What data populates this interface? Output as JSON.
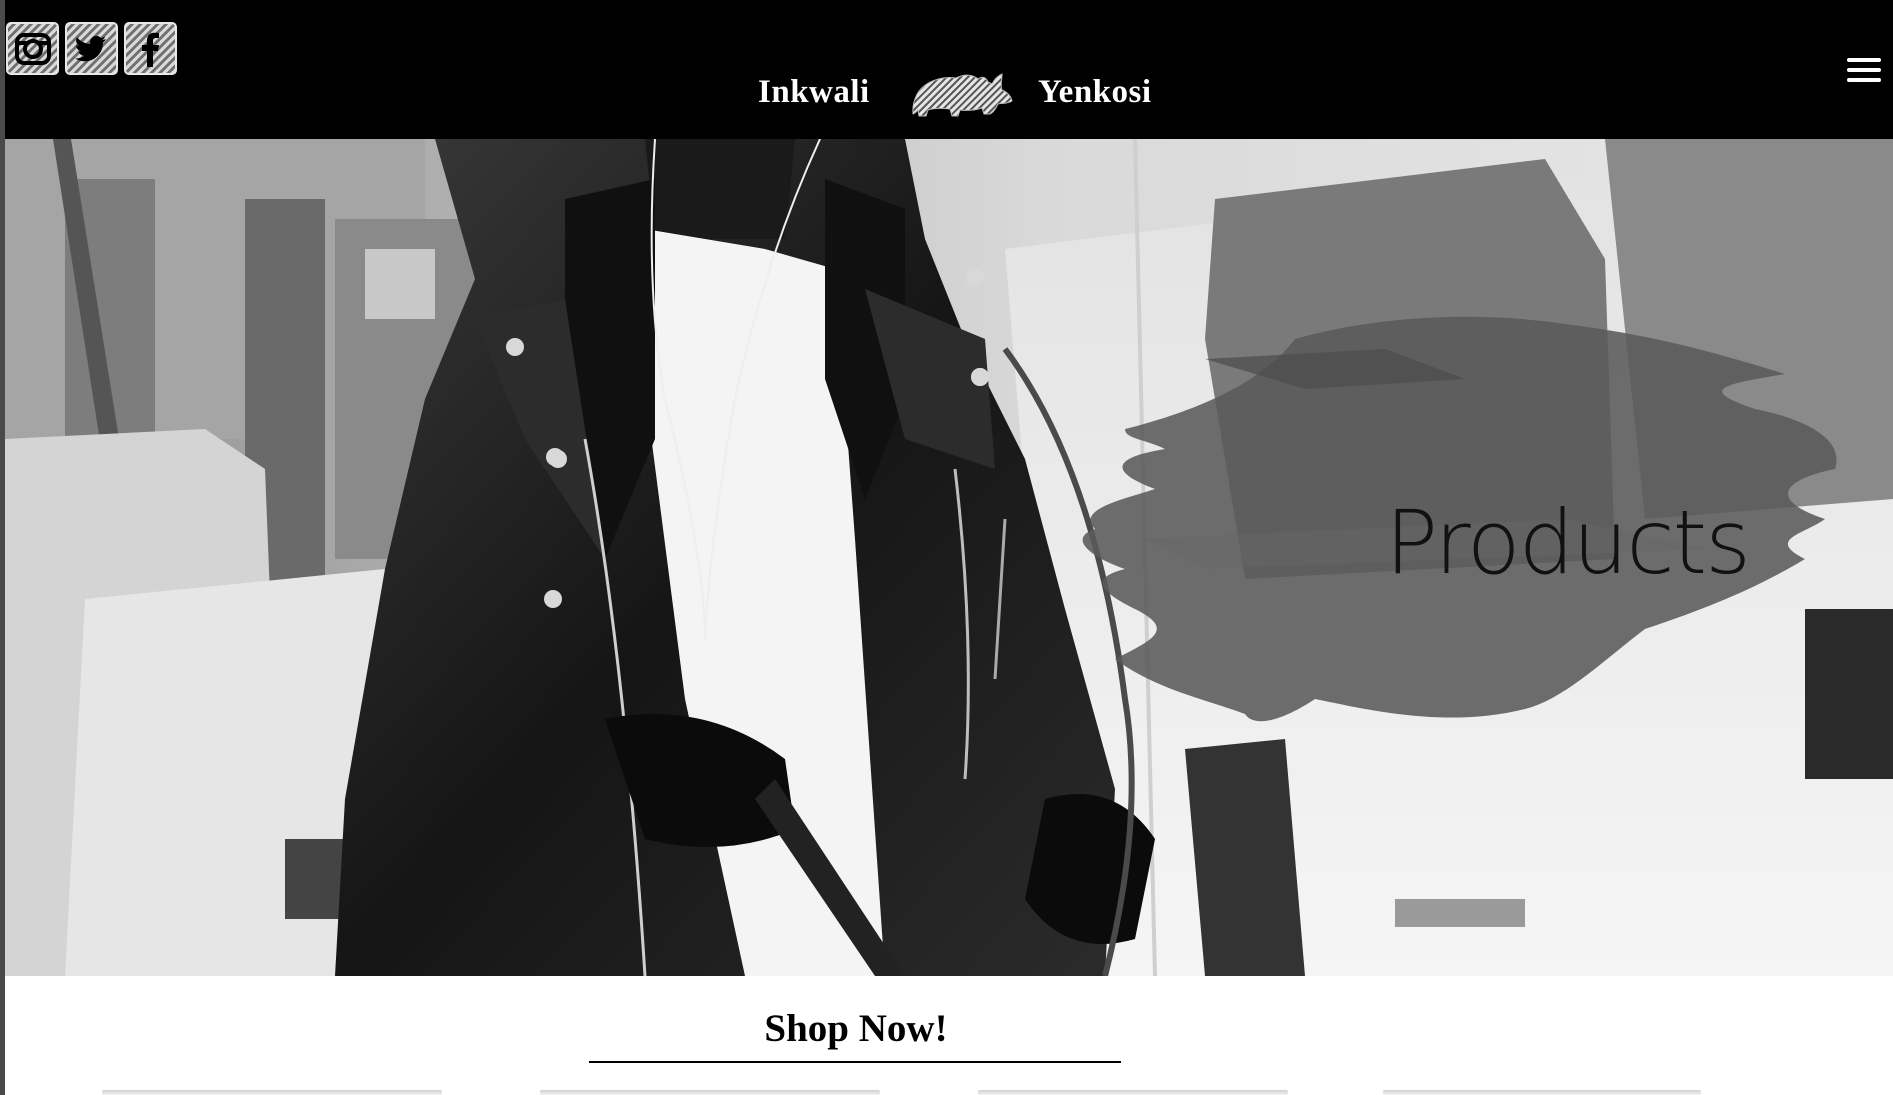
{
  "header": {
    "social": [
      {
        "icon": "instagram-icon",
        "label": "Instagram"
      },
      {
        "icon": "twitter-icon",
        "label": "Twitter"
      },
      {
        "icon": "facebook-icon",
        "label": "Facebook"
      }
    ],
    "brand_left": "Inkwali",
    "brand_right": "Yenkosi",
    "logo_icon": "rhino-logo-icon",
    "menu_icon": "hamburger-menu-icon"
  },
  "hero": {
    "label": "Products"
  },
  "shop": {
    "heading": "Shop Now!"
  },
  "colors": {
    "header_bg": "#000000",
    "header_text": "#ffffff",
    "page_bg": "#ffffff",
    "brush_stroke": "#5a5a5a"
  }
}
